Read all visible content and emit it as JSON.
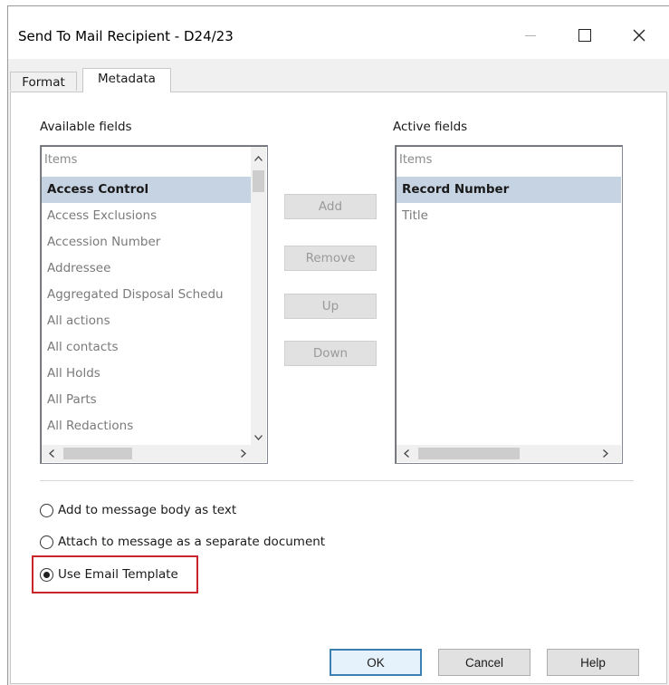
{
  "window": {
    "title": "Send To Mail Recipient - D24/23",
    "controls": [
      "minimize-icon",
      "maximize-icon",
      "close-icon"
    ]
  },
  "tabs": [
    {
      "label": "Format",
      "active": false
    },
    {
      "label": "Metadata",
      "active": true
    }
  ],
  "available": {
    "label": "Available fields",
    "header": "Items",
    "items": [
      {
        "label": "Access Control",
        "selected": true
      },
      {
        "label": "Access Exclusions",
        "selected": false
      },
      {
        "label": "Accession Number",
        "selected": false
      },
      {
        "label": "Addressee",
        "selected": false
      },
      {
        "label": "Aggregated Disposal Schedu",
        "selected": false
      },
      {
        "label": "All actions",
        "selected": false
      },
      {
        "label": "All contacts",
        "selected": false
      },
      {
        "label": "All Holds",
        "selected": false
      },
      {
        "label": "All Parts",
        "selected": false
      },
      {
        "label": "All Redactions",
        "selected": false
      }
    ]
  },
  "active": {
    "label": "Active fields",
    "header": "Items",
    "items": [
      {
        "label": "Record Number",
        "selected": true
      },
      {
        "label": "Title",
        "selected": false
      }
    ]
  },
  "buttons": {
    "add": "Add",
    "remove": "Remove",
    "up": "Up",
    "down": "Down"
  },
  "options": {
    "body": "Add to message body as text",
    "attach": "Attach to message as a separate document",
    "template": "Use Email Template",
    "selected": "template",
    "highlight_color": "#c8262a"
  },
  "footer": {
    "ok": "OK",
    "cancel": "Cancel",
    "help": "Help"
  }
}
